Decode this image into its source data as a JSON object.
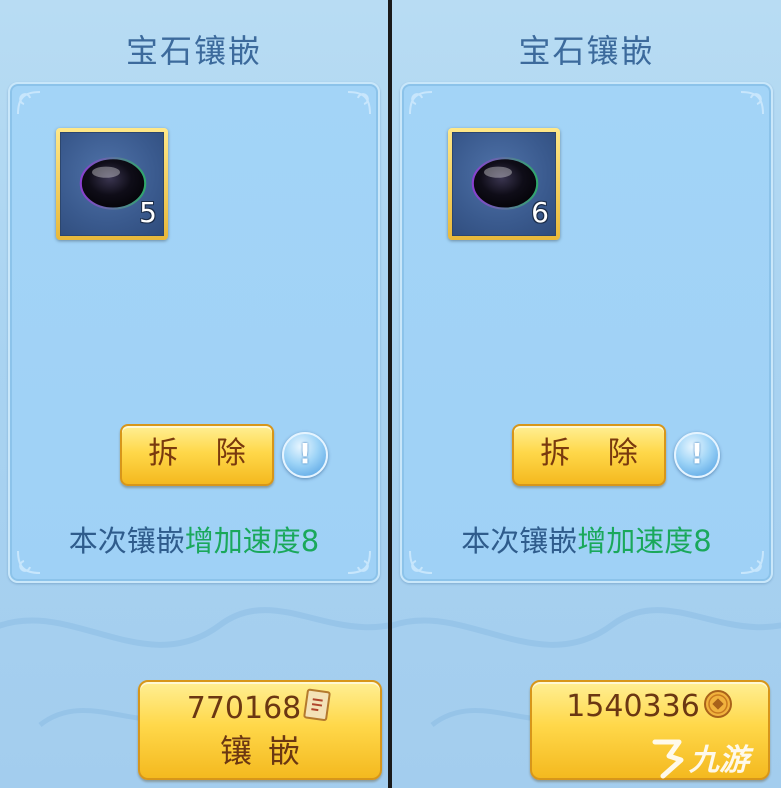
{
  "panels": [
    {
      "title": "宝石镶嵌",
      "gem_count": "5",
      "remove_label": "拆 除",
      "info_mark": "!",
      "effect_prefix": "本次镶嵌",
      "effect_bonus": "增加速度8",
      "cost": "770168",
      "cost_icon": "scroll-coupon-icon",
      "inlay_label": "镶嵌"
    },
    {
      "title": "宝石镶嵌",
      "gem_count": "6",
      "remove_label": "拆 除",
      "info_mark": "!",
      "effect_prefix": "本次镶嵌",
      "effect_bonus": "增加速度8",
      "cost": "1540336",
      "cost_icon": "copper-coin-icon",
      "inlay_label": ""
    }
  ],
  "watermark": {
    "text": "九游",
    "icon": "jiuyou-logo-icon"
  },
  "colors": {
    "title": "#3c6a9c",
    "bonus_text": "#1aa85b",
    "button_gold": "#ffd84a",
    "panel_bg": "#a9d3f1"
  }
}
